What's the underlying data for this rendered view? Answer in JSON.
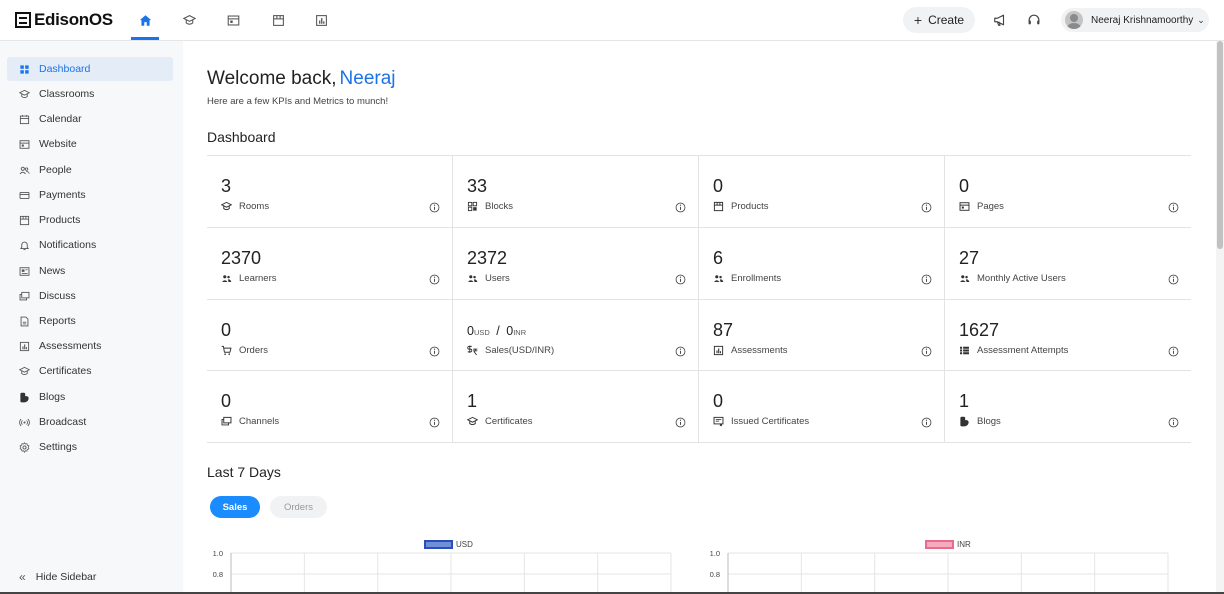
{
  "app": {
    "logo_text": "EdisonOS"
  },
  "topnav": {
    "tabs": [
      {
        "icon": "home-icon",
        "active": true
      },
      {
        "icon": "classroom-icon",
        "active": false
      },
      {
        "icon": "website-icon",
        "active": false
      },
      {
        "icon": "store-icon",
        "active": false
      },
      {
        "icon": "reports-icon",
        "active": false
      }
    ],
    "create_label": "Create",
    "user_name": "Neeraj Krishnamoorthy"
  },
  "sidebar": {
    "items": [
      {
        "label": "Dashboard",
        "icon": "grid-icon",
        "active": true
      },
      {
        "label": "Classrooms",
        "icon": "classroom-icon"
      },
      {
        "label": "Calendar",
        "icon": "calendar-icon"
      },
      {
        "label": "Website",
        "icon": "website-icon"
      },
      {
        "label": "People",
        "icon": "people-icon"
      },
      {
        "label": "Payments",
        "icon": "payments-icon"
      },
      {
        "label": "Products",
        "icon": "store-icon"
      },
      {
        "label": "Notifications",
        "icon": "bell-icon"
      },
      {
        "label": "News",
        "icon": "news-icon"
      },
      {
        "label": "Discuss",
        "icon": "discuss-icon"
      },
      {
        "label": "Reports",
        "icon": "reports-icon"
      },
      {
        "label": "Assessments",
        "icon": "assessments-icon"
      },
      {
        "label": "Certificates",
        "icon": "certificate-icon"
      },
      {
        "label": "Blogs",
        "icon": "blogs-icon"
      },
      {
        "label": "Broadcast",
        "icon": "broadcast-icon"
      },
      {
        "label": "Settings",
        "icon": "settings-icon"
      }
    ],
    "hide_label": "Hide Sidebar"
  },
  "main": {
    "welcome_prefix": "Welcome back,",
    "welcome_name": "Neeraj",
    "subtitle": "Here are a few KPIs and Metrics to munch!",
    "dashboard_heading": "Dashboard",
    "last7_heading": "Last 7 Days",
    "tabs": {
      "sales": "Sales",
      "orders": "Orders"
    }
  },
  "kpis": [
    {
      "value": "3",
      "label": "Rooms",
      "icon": "classroom-icon"
    },
    {
      "value": "33",
      "label": "Blocks",
      "icon": "blocks-icon"
    },
    {
      "value": "0",
      "label": "Products",
      "icon": "store-icon"
    },
    {
      "value": "0",
      "label": "Pages",
      "icon": "website-icon"
    },
    {
      "value": "2370",
      "label": "Learners",
      "icon": "people-icon"
    },
    {
      "value": "2372",
      "label": "Users",
      "icon": "people-icon"
    },
    {
      "value": "6",
      "label": "Enrollments",
      "icon": "people-icon"
    },
    {
      "value": "27",
      "label": "Monthly Active Users",
      "icon": "people-icon"
    },
    {
      "value": "0",
      "label": "Orders",
      "icon": "cart-icon"
    },
    {
      "value_usd": "0",
      "unit_usd": "USD",
      "sep": "/",
      "value_inr": "0",
      "unit_inr": "INR",
      "label": "Sales(USD/INR)",
      "icon": "currency-icon"
    },
    {
      "value": "87",
      "label": "Assessments",
      "icon": "assessments-icon"
    },
    {
      "value": "1627",
      "label": "Assessment Attempts",
      "icon": "list-icon"
    },
    {
      "value": "0",
      "label": "Channels",
      "icon": "discuss-icon"
    },
    {
      "value": "1",
      "label": "Certificates",
      "icon": "certificate-icon"
    },
    {
      "value": "0",
      "label": "Issued Certificates",
      "icon": "certificate-issued-icon"
    },
    {
      "value": "1",
      "label": "Blogs",
      "icon": "blogs-icon"
    }
  ],
  "chart_data": [
    {
      "type": "bar",
      "series": [
        {
          "name": "USD",
          "values": []
        }
      ],
      "yticks": [
        "1.0",
        "0.8"
      ],
      "ylim": [
        0,
        1.0
      ],
      "grid": true,
      "legend": "top-center",
      "color": "#4472ca"
    },
    {
      "type": "bar",
      "series": [
        {
          "name": "INR",
          "values": []
        }
      ],
      "yticks": [
        "1.0",
        "0.8"
      ],
      "ylim": [
        0,
        1.0
      ],
      "grid": true,
      "legend": "top-center",
      "color": "#f28ca7"
    }
  ],
  "colors": {
    "accent": "#1a73e8",
    "pill_active": "#1a8cff"
  }
}
